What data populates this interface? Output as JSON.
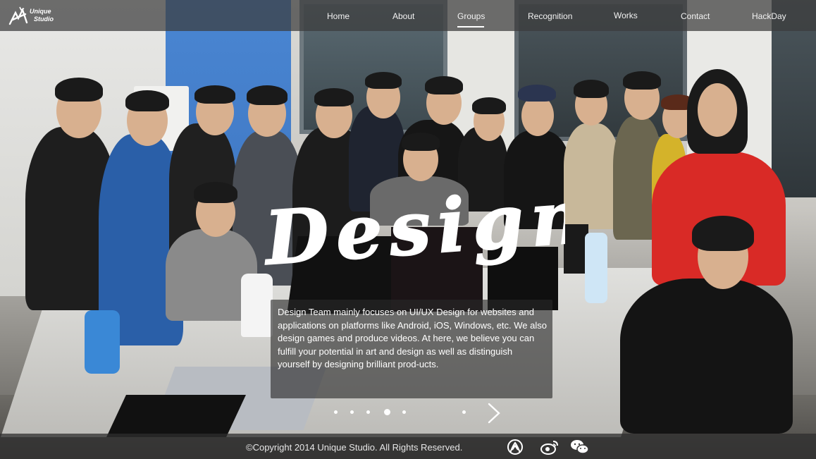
{
  "header": {
    "logo": {
      "line1": "Unique",
      "line2": "Studio"
    },
    "nav": [
      {
        "label": "Home"
      },
      {
        "label": "About"
      },
      {
        "label": "Groups"
      },
      {
        "label": "Recognition"
      },
      {
        "label": "Works"
      },
      {
        "label": "Contact"
      },
      {
        "label": "HackDay"
      }
    ],
    "active_nav": "Groups"
  },
  "hero": {
    "title": "Design",
    "description": "Design Team mainly focuses on UI/UX Design for websites and applications on platforms like Android, iOS, Windows, etc. We also design games and produce videos. At here, we believe you can fulfill your potential in art and design as well as distinguish yourself by designing brilliant prod-ucts."
  },
  "carousel": {
    "dot_count": 6,
    "active_index": 2,
    "next_icon": "chevron-right-icon"
  },
  "footer": {
    "copyright": "©Copyright 2014 Unique Studio. All Rights Reserved.",
    "social": [
      {
        "icon": "renren-icon"
      },
      {
        "icon": "weibo-icon"
      },
      {
        "icon": "wechat-icon"
      }
    ]
  },
  "colors": {
    "nav_bar": "#3c3c3c",
    "text": "#ffffff",
    "wall_blue": "#4a86d2"
  }
}
